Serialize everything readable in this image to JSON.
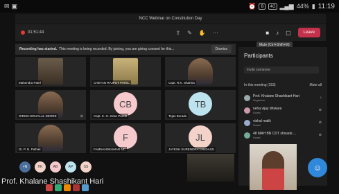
{
  "status_bar": {
    "battery_pct": "44%",
    "time": "11:19",
    "chips": [
      "B",
      "4G"
    ]
  },
  "window": {
    "title": "NCC Webinar on Constitution Day"
  },
  "toolbar": {
    "duration": "01:51:44",
    "leave_label": "Leave"
  },
  "banner": {
    "bold_text": "Recording has started.",
    "text": "This meeting is being recorded. By joining, you are giving consent for this...",
    "dismiss_label": "Dismiss"
  },
  "tooltip": {
    "text": "Mute (Ctrl+Shift+M)"
  },
  "tiles": [
    {
      "name": "Mahendra Patel",
      "type": "photo"
    },
    {
      "name": "CHETAN RAJPUT PATEL",
      "type": "photo"
    },
    {
      "name": "Capt. R.K. Sharma",
      "type": "photo"
    },
    {
      "name": "GIRISH BRIJALAL DEORE",
      "type": "photo"
    },
    {
      "name": "Capt. K. G. Kiran Pandit",
      "initials": "CB",
      "type": "avatar",
      "color": "#f6c9cc"
    },
    {
      "name": "Tejas Borade",
      "initials": "TB",
      "type": "avatar",
      "color": "#bde3ef"
    },
    {
      "name": "Dr. P. N. Pathak",
      "type": "photo"
    },
    {
      "name": "FAMNANDKUMAR NC",
      "initials": "F",
      "type": "avatar",
      "color": "#f6c9cc"
    },
    {
      "name": "JAYESH SURENDRA LANDAGE",
      "initials": "JL",
      "type": "avatar",
      "color": "#f3d3c9"
    }
  ],
  "bottom_avatars": [
    {
      "initials": "+N",
      "color": "#4b6e9b"
    },
    {
      "initials": "HK",
      "color": "#f3d3c9"
    },
    {
      "initials": "AB",
      "color": "#f6c9cc"
    },
    {
      "initials": "AP",
      "color": "#bde3ef"
    },
    {
      "initials": "SS",
      "color": "#f3d3c9"
    }
  ],
  "speaker": {
    "name": "Prof. Khalane Shashikant Hari"
  },
  "panel": {
    "title": "Participants",
    "invite_placeholder": "Invite someone",
    "section_label": "In this meeting (153)",
    "mute_all_label": "Mute all",
    "participants": [
      {
        "name": "Prof. Khalane Shashikant Hari",
        "sub": "Organizer"
      },
      {
        "name": "neha vijay dhiware",
        "sub": "Guest"
      },
      {
        "name": "vishal malik",
        "sub": "Guest"
      },
      {
        "name": "48 MAH BN CDT shivade ... ",
        "sub": "Guest"
      }
    ]
  }
}
